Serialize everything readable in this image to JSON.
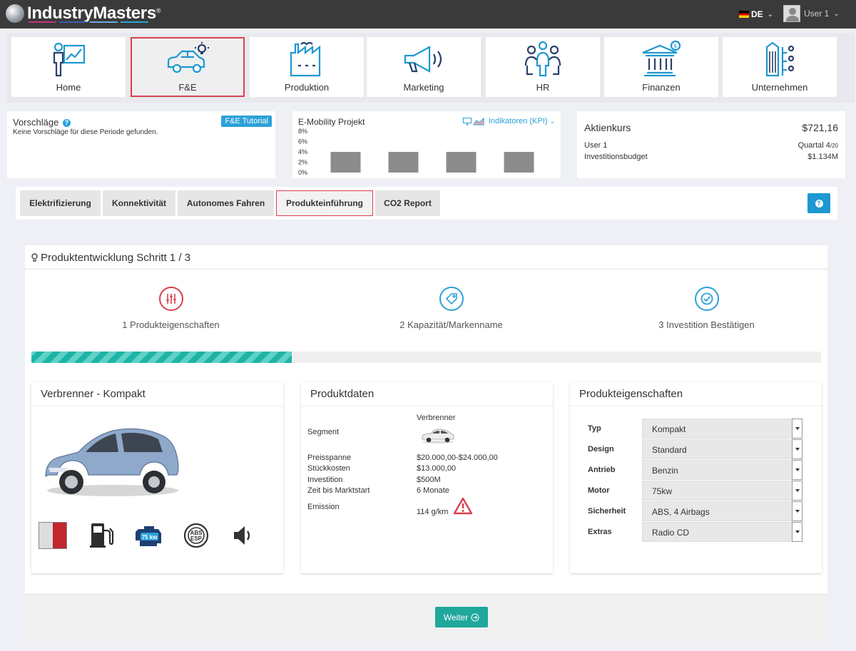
{
  "header": {
    "logo_text": "IndustryMasters",
    "logo_mark": "®",
    "language": "DE",
    "user": "User 1"
  },
  "nav": {
    "tiles": [
      {
        "label": "Home",
        "icon": "home-chart-icon"
      },
      {
        "label": "F&E",
        "icon": "car-idea-icon"
      },
      {
        "label": "Produktion",
        "icon": "factory-icon"
      },
      {
        "label": "Marketing",
        "icon": "megaphone-icon"
      },
      {
        "label": "HR",
        "icon": "people-icon"
      },
      {
        "label": "Finanzen",
        "icon": "bank-icon"
      },
      {
        "label": "Unternehmen",
        "icon": "building-icon"
      }
    ],
    "active": "F&E"
  },
  "suggestions": {
    "title": "Vorschläge",
    "text": "Keine Vorschläge für diese Periode gefunden.",
    "tutorial_label": "F&E Tutorial"
  },
  "emobility": {
    "title": "E-Mobility Projekt",
    "kpi_label": "Indikatoren (KPI)",
    "chart_data": {
      "type": "bar",
      "values": [
        4,
        4,
        4,
        4
      ],
      "y_ticks": [
        "8%",
        "6%",
        "4%",
        "2%",
        "0%"
      ],
      "ylim": [
        0,
        8
      ]
    }
  },
  "stock": {
    "title": "Aktienkurs",
    "value": "$721,16",
    "user": "User 1",
    "quarter_label": "Quartal",
    "quarter": "4",
    "quarter_total": "/20",
    "budget_label": "Investitionsbudget",
    "budget": "$1.134M"
  },
  "tabs": [
    "Elektrifizierung",
    "Konnektivität",
    "Autonomes Fahren",
    "Produkteinführung",
    "CO2 Report"
  ],
  "active_tab": "Produkteinführung",
  "wizard": {
    "title": "Produktentwicklung Schritt 1 / 3",
    "steps": [
      "1 Produkteigenschaften",
      "2 Kapazität/Markenname",
      "3 Investition Bestätigen"
    ],
    "progress": 0.33
  },
  "product": {
    "title": "Verbrenner - Kompakt",
    "feature_icons": [
      "paint-swatch-icon",
      "fuel-pump-icon",
      "engine-icon",
      "abs-esp-icon",
      "speaker-icon"
    ],
    "engine_badge": "75 kw",
    "abs_badge_top": "ABS",
    "abs_badge_bottom": "ESP"
  },
  "productdata": {
    "title": "Produktdaten",
    "segment_label": "Segment",
    "segment_value": "Verbrenner",
    "rows": [
      {
        "label": "Preisspanne",
        "value": "$20.000,00-$24.000,00"
      },
      {
        "label": "Stückkosten",
        "value": "$13.000,00"
      },
      {
        "label": "Investition",
        "value": "$500M"
      },
      {
        "label": "Zeit bis Marktstart",
        "value": "6 Monate"
      }
    ],
    "emission_label": "Emission",
    "emission_value": "114 g/km"
  },
  "properties": {
    "title": "Produkteigenschaften",
    "rows": [
      {
        "label": "Typ",
        "value": "Kompakt"
      },
      {
        "label": "Design",
        "value": "Standard"
      },
      {
        "label": "Antrieb",
        "value": "Benzin"
      },
      {
        "label": "Motor",
        "value": "75kw"
      },
      {
        "label": "Sicherheit",
        "value": "ABS, 4 Airbags"
      },
      {
        "label": "Extras",
        "value": "Radio CD"
      }
    ]
  },
  "footer": {
    "next_label": "Weiter"
  },
  "colors": {
    "accent_blue": "#2ba1d9",
    "accent_red": "#d9414f",
    "teal": "#1fa89b",
    "topbar": "#3a3a3a"
  }
}
